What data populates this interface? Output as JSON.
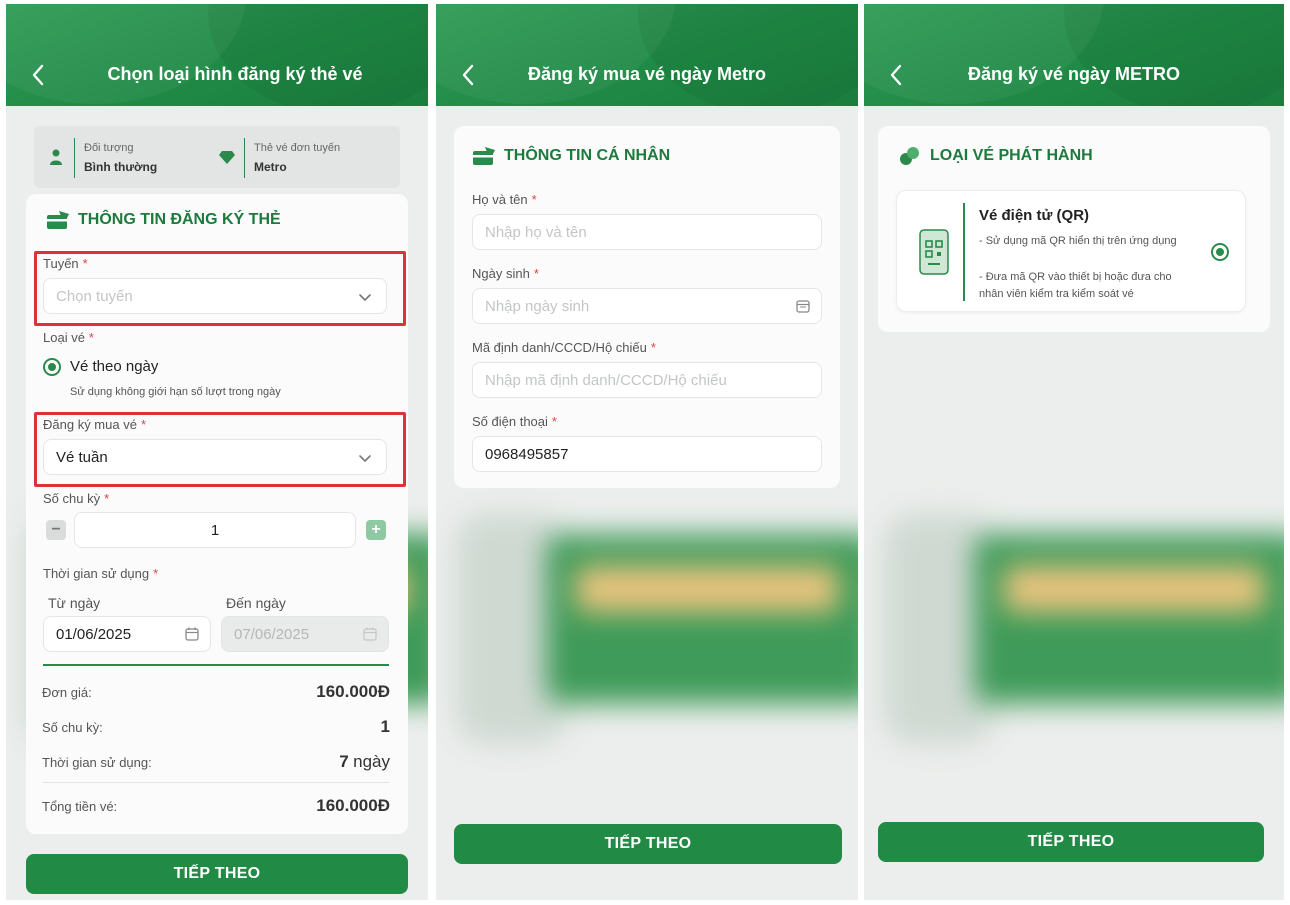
{
  "screen1": {
    "title": "Chọn loại hình đăng ký thẻ vé",
    "info": {
      "object_label": "Đối tượng",
      "object_value": "Bình thường",
      "card_label": "Thẻ vé đơn tuyến",
      "card_value": "Metro"
    },
    "section_title": "THÔNG TIN ĐĂNG KÝ THẺ",
    "route_label": "Tuyến",
    "route_placeholder": "Chọn tuyến",
    "ticket_type_label": "Loại vé",
    "ticket_option": "Vé theo ngày",
    "ticket_option_desc": "Sử dụng không giới hạn số lượt trong ngày",
    "purchase_label": "Đăng ký mua vé",
    "purchase_value": "Vé tuần",
    "cycles_label": "Số chu kỳ",
    "cycles_value": "1",
    "usage_time_label": "Thời gian sử dụng",
    "from_label": "Từ ngày",
    "from_value": "01/06/2025",
    "to_label": "Đến ngày",
    "to_value": "07/06/2025",
    "summary": {
      "unit_price_label": "Đơn giá:",
      "unit_price_value": "160.000Đ",
      "cycles_label": "Số chu kỳ:",
      "cycles_value": "1",
      "usage_label": "Thời gian sử dụng:",
      "usage_number": "7",
      "usage_unit": "ngày",
      "total_label": "Tổng tiền vé:",
      "total_value": "160.000Đ"
    },
    "next_button": "TIẾP THEO",
    "required_mark": "*"
  },
  "screen2": {
    "title": "Đăng ký mua vé ngày Metro",
    "section_title": "THÔNG TIN CÁ NHÂN",
    "name_label": "Họ và tên",
    "name_placeholder": "Nhập họ và tên",
    "dob_label": "Ngày sinh",
    "dob_placeholder": "Nhập ngày sinh",
    "id_label": "Mã định danh/CCCD/Hộ chiếu",
    "id_placeholder": "Nhập mã định danh/CCCD/Hộ chiếu",
    "phone_label": "Số điện thoại",
    "phone_value": "0968495857",
    "next_button": "TIẾP THEO",
    "required_mark": "*"
  },
  "screen3": {
    "title": "Đăng ký vé ngày METRO",
    "section_title": "LOẠI VÉ PHÁT HÀNH",
    "option_title": "Vé điện tử (QR)",
    "option_desc_1": "- Sử dụng mã QR hiển thị trên ứng dụng",
    "option_desc_2": "- Đưa mã QR vào thiết bị hoặc đưa cho nhân viên kiểm tra kiểm soát vé",
    "next_button": "TIẾP THEO"
  },
  "colors": {
    "primary_green": "#218a45",
    "required_red": "#d44444",
    "highlight_red": "#d9343a"
  }
}
